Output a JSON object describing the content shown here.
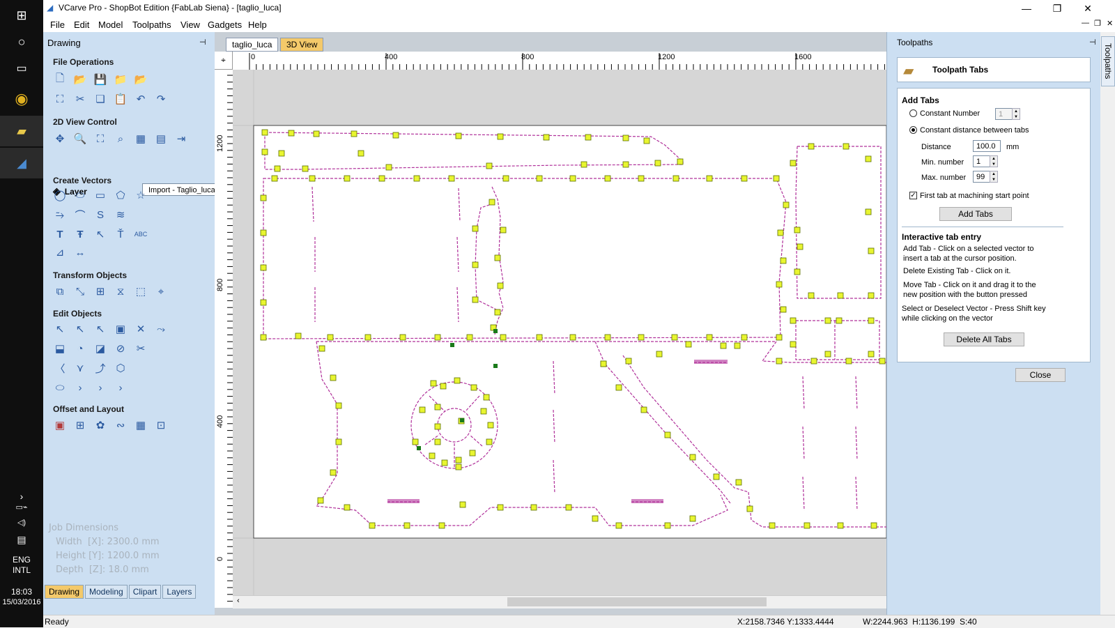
{
  "app": {
    "title": "VCarve Pro - ShopBot Edition {FabLab Siena} - [taglio_luca]"
  },
  "menu": [
    "File",
    "Edit",
    "Model",
    "Toolpaths",
    "View",
    "Gadgets",
    "Help"
  ],
  "taskbar": {
    "lang1": "ENG",
    "lang2": "INTL",
    "time": "18:03",
    "date": "15/03/2016"
  },
  "drawing_panel": {
    "title": "Drawing",
    "sections": {
      "file_ops": "File Operations",
      "view_ctrl": "2D View Control",
      "create_vectors": "Create Vectors",
      "transform": "Transform Objects",
      "edit": "Edit Objects",
      "offset": "Offset and Layout"
    },
    "layer_label": "Layer",
    "layer_value": "Import - Taglio_luca",
    "job_dimensions": {
      "title": "Job Dimensions",
      "width": "Width  [X]: 2300.0 mm",
      "height": "Height [Y]: 1200.0 mm",
      "depth": "Depth  [Z]: 18.0 mm"
    },
    "bottom_tabs": [
      "Drawing",
      "Modeling",
      "Clipart",
      "Layers"
    ]
  },
  "document": {
    "tabs": [
      "taglio_luca",
      "3D View"
    ],
    "ruler_h": [
      "0",
      "400",
      "800",
      "1200",
      "1600"
    ],
    "ruler_v": [
      "1200",
      "800",
      "400",
      "0"
    ]
  },
  "toolpaths_panel": {
    "title": "Toolpaths",
    "side_tab": "Toolpaths",
    "header": "Toolpath Tabs",
    "add_tabs": {
      "title": "Add Tabs",
      "constant_number": "Constant Number",
      "constant_number_value": "1",
      "constant_distance": "Constant distance between tabs",
      "distance_label": "Distance",
      "distance_value": "100.0",
      "distance_unit": "mm",
      "min_label": "Min. number",
      "min_value": "1",
      "max_label": "Max. number",
      "max_value": "99",
      "first_tab": "First tab at machining start point",
      "add_button": "Add Tabs"
    },
    "interactive": {
      "title": "Interactive tab entry",
      "line1a": "Add Tab - Click on a selected vector to",
      "line1b": "insert a tab at the cursor position.",
      "line2": "Delete Existing Tab - Click on it.",
      "line3a": "Move Tab - Click on it and drag it to the",
      "line3b": "new position with the button pressed",
      "line4a": "Select or Deselect Vector - Press Shift key",
      "line4b": "while clicking on the vector",
      "delete_button": "Delete All Tabs"
    },
    "close_button": "Close"
  },
  "status": {
    "ready": "Ready",
    "coords": "X:2158.7346 Y:1333.4444",
    "dims": "W:2244.963  H:1136.199  S:40"
  },
  "colors": {
    "panel_bg": "#ccdff2",
    "vector": "#b0309a",
    "tab_marker": "#e8f530",
    "active_tab": "#f4c96a"
  }
}
